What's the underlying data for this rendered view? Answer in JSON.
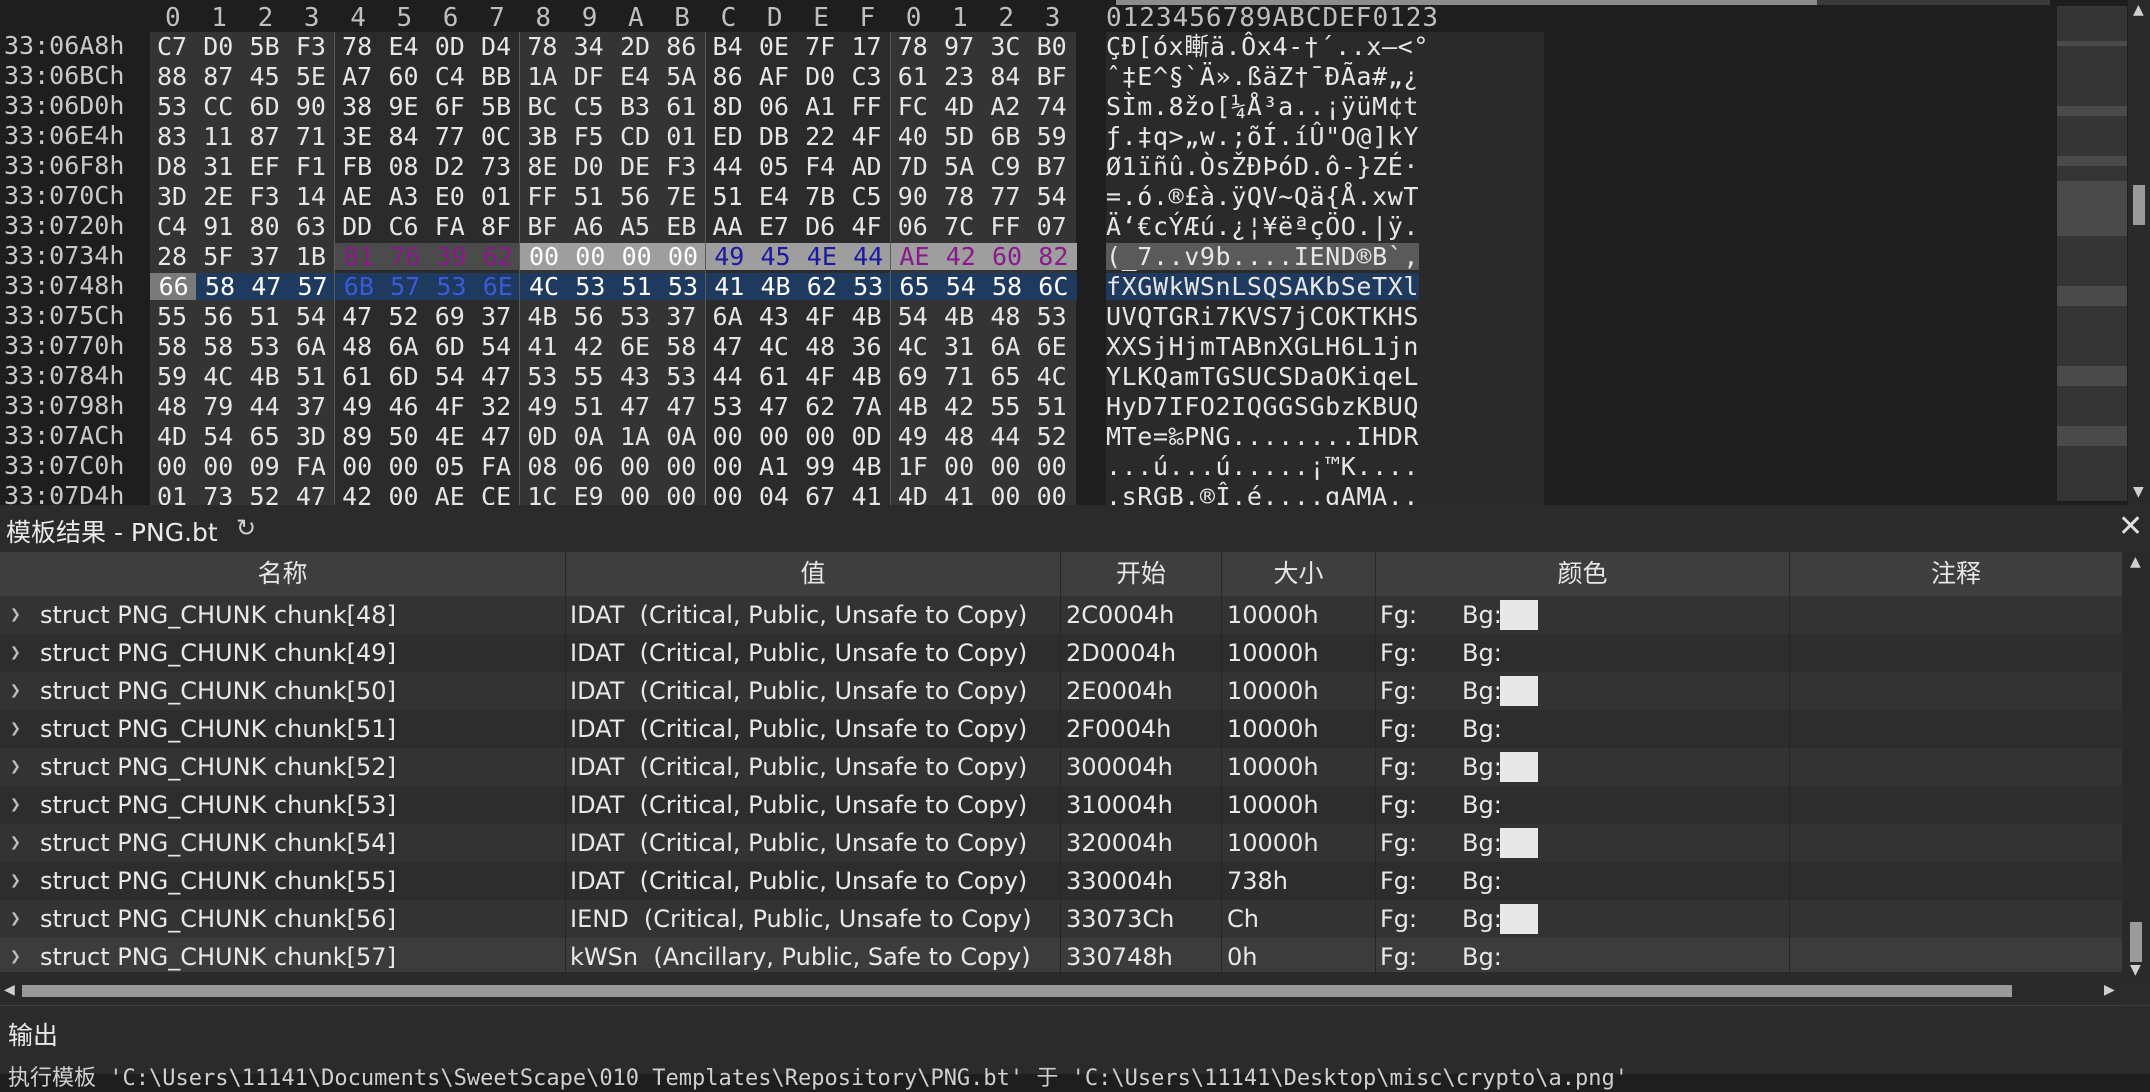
{
  "hex": {
    "column_headers": [
      "0",
      "1",
      "2",
      "3",
      "4",
      "5",
      "6",
      "7",
      "8",
      "9",
      "A",
      "B",
      "C",
      "D",
      "E",
      "F",
      "0",
      "1",
      "2",
      "3"
    ],
    "ascii_header": "0123456789ABCDEF0123",
    "rows": [
      {
        "addr": "33:06A8h",
        "bytes": [
          "C7",
          "D0",
          "5B",
          "F3",
          "78",
          "E4",
          "0D",
          "D4",
          "78",
          "34",
          "2D",
          "86",
          "B4",
          "0E",
          "7F",
          "17",
          "78",
          "97",
          "3C",
          "B0"
        ],
        "ascii": "ÇÐ[óx䁪ä.Ôx4-†´..x—<°"
      },
      {
        "addr": "33:06BCh",
        "bytes": [
          "88",
          "87",
          "45",
          "5E",
          "A7",
          "60",
          "C4",
          "BB",
          "1A",
          "DF",
          "E4",
          "5A",
          "86",
          "AF",
          "D0",
          "C3",
          "61",
          "23",
          "84",
          "BF"
        ],
        "ascii": "ˆ‡E^§`Ä».ßäZ†¯ÐÃa#„¿"
      },
      {
        "addr": "33:06D0h",
        "bytes": [
          "53",
          "CC",
          "6D",
          "90",
          "38",
          "9E",
          "6F",
          "5B",
          "BC",
          "C5",
          "B3",
          "61",
          "8D",
          "06",
          "A1",
          "FF",
          "FC",
          "4D",
          "A2",
          "74"
        ],
        "ascii": "SÌm.8žo[¼Å³a..¡ÿüM¢t"
      },
      {
        "addr": "33:06E4h",
        "bytes": [
          "83",
          "11",
          "87",
          "71",
          "3E",
          "84",
          "77",
          "0C",
          "3B",
          "F5",
          "CD",
          "01",
          "ED",
          "DB",
          "22",
          "4F",
          "40",
          "5D",
          "6B",
          "59"
        ],
        "ascii": "ƒ.‡q>„w.;õÍ.íÛ\"O@]kY"
      },
      {
        "addr": "33:06F8h",
        "bytes": [
          "D8",
          "31",
          "EF",
          "F1",
          "FB",
          "08",
          "D2",
          "73",
          "8E",
          "D0",
          "DE",
          "F3",
          "44",
          "05",
          "F4",
          "AD",
          "7D",
          "5A",
          "C9",
          "B7"
        ],
        "ascii": "Ø1ïñû.ÒsŽÐÞóD.ô-}ZÉ·"
      },
      {
        "addr": "33:070Ch",
        "bytes": [
          "3D",
          "2E",
          "F3",
          "14",
          "AE",
          "A3",
          "E0",
          "01",
          "FF",
          "51",
          "56",
          "7E",
          "51",
          "E4",
          "7B",
          "C5",
          "90",
          "78",
          "77",
          "54"
        ],
        "ascii": "=.ó.®£à.ÿQV~Qä{Å.xwT"
      },
      {
        "addr": "33:0720h",
        "bytes": [
          "C4",
          "91",
          "80",
          "63",
          "DD",
          "C6",
          "FA",
          "8F",
          "BF",
          "A6",
          "A5",
          "EB",
          "AA",
          "E7",
          "D6",
          "4F",
          "06",
          "7C",
          "FF",
          "07"
        ],
        "ascii": "Ä‘€cÝÆú.¿¦¥ëªçÖO.|ÿ."
      },
      {
        "addr": "33:0734h",
        "bytes": [
          "28",
          "5F",
          "37",
          "1B",
          "81",
          "76",
          "39",
          "62",
          "00",
          "00",
          "00",
          "00",
          "49",
          "45",
          "4E",
          "44",
          "AE",
          "42",
          "60",
          "82"
        ],
        "ascii": "(_7..v9b....IEND®B`‚"
      },
      {
        "addr": "33:0748h",
        "bytes": [
          "66",
          "58",
          "47",
          "57",
          "6B",
          "57",
          "53",
          "6E",
          "4C",
          "53",
          "51",
          "53",
          "41",
          "4B",
          "62",
          "53",
          "65",
          "54",
          "58",
          "6C"
        ],
        "ascii": "fXGWkWSnLSQSAKbSeTXl"
      },
      {
        "addr": "33:075Ch",
        "bytes": [
          "55",
          "56",
          "51",
          "54",
          "47",
          "52",
          "69",
          "37",
          "4B",
          "56",
          "53",
          "37",
          "6A",
          "43",
          "4F",
          "4B",
          "54",
          "4B",
          "48",
          "53"
        ],
        "ascii": "UVQTGRi7KVS7jCOKTKHS"
      },
      {
        "addr": "33:0770h",
        "bytes": [
          "58",
          "58",
          "53",
          "6A",
          "48",
          "6A",
          "6D",
          "54",
          "41",
          "42",
          "6E",
          "58",
          "47",
          "4C",
          "48",
          "36",
          "4C",
          "31",
          "6A",
          "6E"
        ],
        "ascii": "XXSjHjmTABnXGLH6L1jn"
      },
      {
        "addr": "33:0784h",
        "bytes": [
          "59",
          "4C",
          "4B",
          "51",
          "61",
          "6D",
          "54",
          "47",
          "53",
          "55",
          "43",
          "53",
          "44",
          "61",
          "4F",
          "4B",
          "69",
          "71",
          "65",
          "4C"
        ],
        "ascii": "YLKQamTGSUCSDaOKiqeL"
      },
      {
        "addr": "33:0798h",
        "bytes": [
          "48",
          "79",
          "44",
          "37",
          "49",
          "46",
          "4F",
          "32",
          "49",
          "51",
          "47",
          "47",
          "53",
          "47",
          "62",
          "7A",
          "4B",
          "42",
          "55",
          "51"
        ],
        "ascii": "HyD7IFO2IQGGSGbzKBUQ"
      },
      {
        "addr": "33:07ACh",
        "bytes": [
          "4D",
          "54",
          "65",
          "3D",
          "89",
          "50",
          "4E",
          "47",
          "0D",
          "0A",
          "1A",
          "0A",
          "00",
          "00",
          "00",
          "0D",
          "49",
          "48",
          "44",
          "52"
        ],
        "ascii": "MTe=‰PNG........IHDR"
      },
      {
        "addr": "33:07C0h",
        "bytes": [
          "00",
          "00",
          "09",
          "FA",
          "00",
          "00",
          "05",
          "FA",
          "08",
          "06",
          "00",
          "00",
          "00",
          "A1",
          "99",
          "4B",
          "1F",
          "00",
          "00",
          "00"
        ],
        "ascii": "...ú...ú.....¡™K...."
      },
      {
        "addr": "33:07D4h",
        "bytes": [
          "01",
          "73",
          "52",
          "47",
          "42",
          "00",
          "AE",
          "CE",
          "1C",
          "E9",
          "00",
          "00",
          "00",
          "04",
          "67",
          "41",
          "4D",
          "41",
          "00",
          "00"
        ],
        "ascii": ".sRGB.®Î.é....gAMA.."
      }
    ]
  },
  "template_results": {
    "title": "模板结果 - PNG.bt",
    "columns": [
      "名称",
      "值",
      "开始",
      "大小",
      "颜色",
      "注释"
    ],
    "rows": [
      {
        "name": "struct PNG_CHUNK chunk[48]",
        "value": "IDAT  (Critical, Public, Unsafe to Copy)",
        "start": "2C0004h",
        "size": "10000h",
        "fg": "Fg:",
        "bg": "Bg:",
        "swatch": true
      },
      {
        "name": "struct PNG_CHUNK chunk[49]",
        "value": "IDAT  (Critical, Public, Unsafe to Copy)",
        "start": "2D0004h",
        "size": "10000h",
        "fg": "Fg:",
        "bg": "Bg:",
        "swatch": false
      },
      {
        "name": "struct PNG_CHUNK chunk[50]",
        "value": "IDAT  (Critical, Public, Unsafe to Copy)",
        "start": "2E0004h",
        "size": "10000h",
        "fg": "Fg:",
        "bg": "Bg:",
        "swatch": true
      },
      {
        "name": "struct PNG_CHUNK chunk[51]",
        "value": "IDAT  (Critical, Public, Unsafe to Copy)",
        "start": "2F0004h",
        "size": "10000h",
        "fg": "Fg:",
        "bg": "Bg:",
        "swatch": false
      },
      {
        "name": "struct PNG_CHUNK chunk[52]",
        "value": "IDAT  (Critical, Public, Unsafe to Copy)",
        "start": "300004h",
        "size": "10000h",
        "fg": "Fg:",
        "bg": "Bg:",
        "swatch": true
      },
      {
        "name": "struct PNG_CHUNK chunk[53]",
        "value": "IDAT  (Critical, Public, Unsafe to Copy)",
        "start": "310004h",
        "size": "10000h",
        "fg": "Fg:",
        "bg": "Bg:",
        "swatch": false
      },
      {
        "name": "struct PNG_CHUNK chunk[54]",
        "value": "IDAT  (Critical, Public, Unsafe to Copy)",
        "start": "320004h",
        "size": "10000h",
        "fg": "Fg:",
        "bg": "Bg:",
        "swatch": true
      },
      {
        "name": "struct PNG_CHUNK chunk[55]",
        "value": "IDAT  (Critical, Public, Unsafe to Copy)",
        "start": "330004h",
        "size": "738h",
        "fg": "Fg:",
        "bg": "Bg:",
        "swatch": false
      },
      {
        "name": "struct PNG_CHUNK chunk[56]",
        "value": "IEND  (Critical, Public, Unsafe to Copy)",
        "start": "33073Ch",
        "size": "Ch",
        "fg": "Fg:",
        "bg": "Bg:",
        "swatch": true
      },
      {
        "name": "struct PNG_CHUNK chunk[57]",
        "value": "kWSn  (Ancillary, Public, Safe to Copy)",
        "start": "330748h",
        "size": "0h",
        "fg": "Fg:",
        "bg": "Bg:",
        "swatch": false
      }
    ]
  },
  "output": {
    "title": "输出",
    "line": "执行模板 'C:\\Users\\11141\\Documents\\SweetScape\\010 Templates\\Repository\\PNG.bt' 于 'C:\\Users\\11141\\Desktop\\misc\\crypto\\a.png'"
  },
  "colors": {
    "highlight_purple": "#8a1a8a",
    "highlight_blue": "#1a1aa0",
    "selection_bg": "#1e3a5f",
    "gray_bg": "#9e9e9e",
    "swatch": "#e8e8e8"
  },
  "icons": {
    "refresh": "refresh-icon",
    "close": "close-icon",
    "expander": "chevron-right-icon"
  }
}
